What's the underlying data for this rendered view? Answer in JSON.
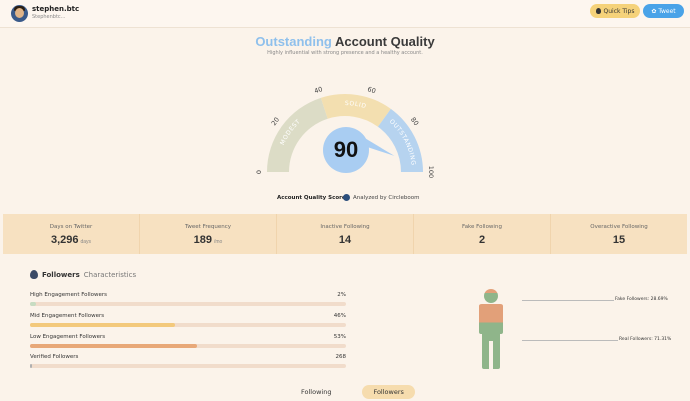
{
  "header": {
    "username": "stephen.btc",
    "handle": "Stephenbtc...",
    "quick_tips_label": "Quick Tips",
    "tweet_label": "Tweet"
  },
  "hero": {
    "title_accent": "Outstanding",
    "title_rest": "Account Quality",
    "subtitle": "Highly influential with strong presence and a healthy account."
  },
  "gauge": {
    "score": "90",
    "score_value": 90,
    "ticks": [
      "0",
      "20",
      "40",
      "60",
      "80",
      "100"
    ],
    "bands": [
      {
        "label": "MODEST",
        "from": 0,
        "to": 40,
        "color": "#dcdcc6"
      },
      {
        "label": "SOLID",
        "from": 40,
        "to": 70,
        "color": "#f3dfb0"
      },
      {
        "label": "OUTSTANDING",
        "from": 70,
        "to": 100,
        "color": "#b6d3ef"
      }
    ],
    "score_label": "Account Quality Score",
    "analyzed_label": "Analyzed by Circleboom"
  },
  "stats": [
    {
      "label": "Days on Twitter",
      "value": "3,296",
      "unit": "days"
    },
    {
      "label": "Tweet Frequency",
      "value": "189",
      "unit": "/mo"
    },
    {
      "label": "Inactive Following",
      "value": "14",
      "unit": ""
    },
    {
      "label": "Fake Following",
      "value": "2",
      "unit": ""
    },
    {
      "label": "Overactive Following",
      "value": "15",
      "unit": ""
    }
  ],
  "followers": {
    "heading_bold": "Followers",
    "heading_rest": "Characteristics",
    "metrics": [
      {
        "label": "High Engagement Followers",
        "value": "2%",
        "fill": 0.02,
        "color": "#c7dcc2"
      },
      {
        "label": "Mid Engagement Followers",
        "value": "46%",
        "fill": 0.46,
        "color": "#f3c97c"
      },
      {
        "label": "Low Engagement Followers",
        "value": "53%",
        "fill": 0.53,
        "color": "#e8a878"
      },
      {
        "label": "Verified Followers",
        "value": "268",
        "fill": 0.002,
        "color": "#b0b0b0"
      }
    ],
    "fake_label": "Fake Followers: 28.69%",
    "real_label": "Real Followers: 71.31%",
    "fake_share": 0.2869,
    "colors": {
      "fake": "#e2a079",
      "real": "#8fb58a"
    }
  },
  "tabs": {
    "following": "Following",
    "followers": "Followers"
  }
}
